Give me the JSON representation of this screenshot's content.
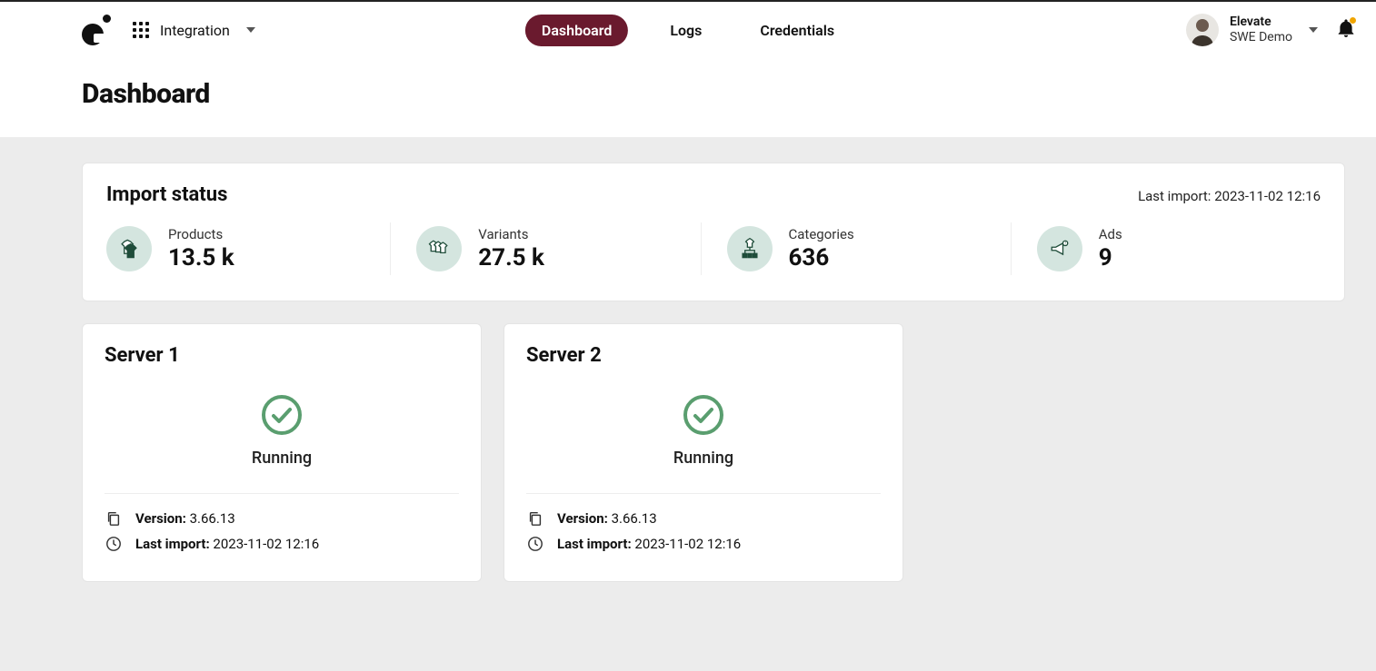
{
  "header": {
    "app_name": "Integration",
    "nav": {
      "dashboard": "Dashboard",
      "logs": "Logs",
      "credentials": "Credentials"
    },
    "user": {
      "line1": "Elevate",
      "line2": "SWE Demo"
    }
  },
  "page": {
    "title": "Dashboard"
  },
  "import_status": {
    "title": "Import status",
    "last_import_label": "Last import:",
    "last_import_value": "2023-11-02 12:16",
    "stats": {
      "products": {
        "label": "Products",
        "value": "13.5 k"
      },
      "variants": {
        "label": "Variants",
        "value": "27.5 k"
      },
      "categories": {
        "label": "Categories",
        "value": "636"
      },
      "ads": {
        "label": "Ads",
        "value": "9"
      }
    }
  },
  "servers": [
    {
      "title": "Server 1",
      "status": "Running",
      "version_label": "Version:",
      "version_value": "3.66.13",
      "last_import_label": "Last import:",
      "last_import_value": "2023-11-02 12:16"
    },
    {
      "title": "Server 2",
      "status": "Running",
      "version_label": "Version:",
      "version_value": "3.66.13",
      "last_import_label": "Last import:",
      "last_import_value": "2023-11-02 12:16"
    }
  ]
}
